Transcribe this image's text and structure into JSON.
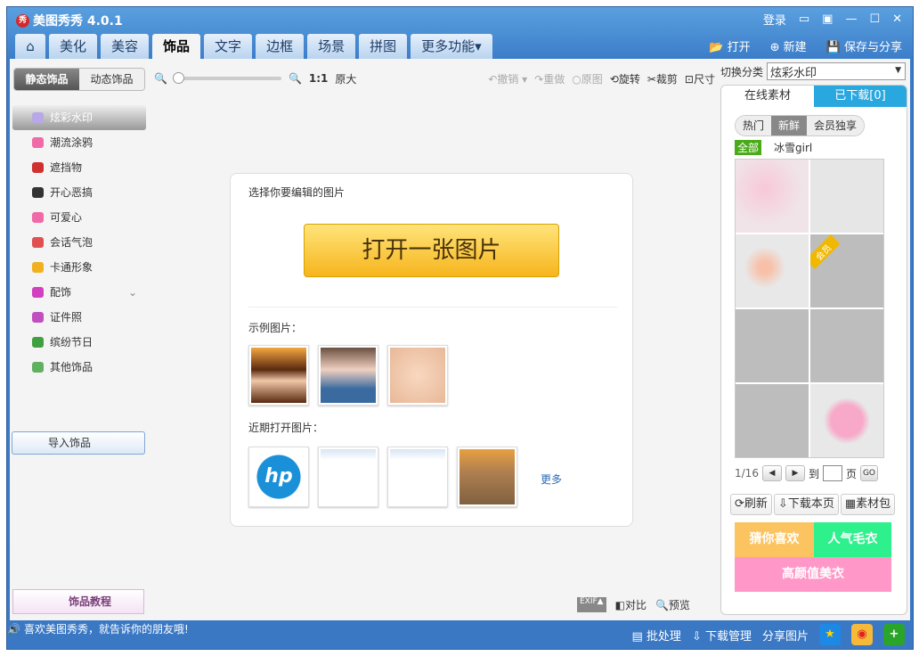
{
  "window": {
    "title": "美图秀秀 4.0.1",
    "logo": "秀",
    "login": "登录"
  },
  "tabs": [
    "美化",
    "美容",
    "饰品",
    "文字",
    "边框",
    "场景",
    "拼图",
    "更多功能▾"
  ],
  "top_actions": {
    "open": "打开",
    "new": "新建",
    "save": "保存与分享"
  },
  "left": {
    "subtabs": [
      "静态饰品",
      "动态饰品"
    ],
    "categories": [
      {
        "label": "炫彩水印",
        "color": "#b9a8e8"
      },
      {
        "label": "潮流涂鸦",
        "color": "#f06aa8"
      },
      {
        "label": "遮挡物",
        "color": "#d03030"
      },
      {
        "label": "开心恶搞",
        "color": "#333333"
      },
      {
        "label": "可爱心",
        "color": "#f06aa8"
      },
      {
        "label": "会话气泡",
        "color": "#e05050"
      },
      {
        "label": "卡通形象",
        "color": "#f0b020"
      },
      {
        "label": "配饰",
        "color": "#d040c0"
      },
      {
        "label": "证件照",
        "color": "#c050c0"
      },
      {
        "label": "缤纷节日",
        "color": "#40a040"
      },
      {
        "label": "其他饰品",
        "color": "#60b060"
      }
    ],
    "import": "导入饰品",
    "tutorial": "饰品教程"
  },
  "toolbar": {
    "zoom_label": "1:1",
    "original_size": "原大",
    "undo": "撤销",
    "redo": "重做",
    "original": "原图",
    "rotate": "旋转",
    "crop": "裁剪",
    "size": "尺寸"
  },
  "canvas": {
    "prompt": "选择你要编辑的图片",
    "open_button": "打开一张图片",
    "examples_label": "示例图片：",
    "recent_label": "近期打开图片：",
    "more": "更多"
  },
  "bottom_tools": {
    "exif": "EXIF▲",
    "compare": "对比",
    "preview": "预览"
  },
  "right": {
    "category_label": "切换分类",
    "category_value": "炫彩水印",
    "tabs": [
      "在线素材",
      "已下载[0]"
    ],
    "filters": [
      "热门",
      "新鲜",
      "会员独享"
    ],
    "tags": [
      "全部",
      "冰雪girl"
    ],
    "member_badge": "会员",
    "page": "1/16",
    "goto": "到",
    "page_unit": "页",
    "go": "GO",
    "buttons": [
      "刷新",
      "下载本页",
      "素材包"
    ],
    "promos": [
      "猜你喜欢",
      "人气毛衣",
      "高颜值美衣"
    ]
  },
  "status": {
    "message": "喜欢美图秀秀，就告诉你的朋友哦!",
    "batch": "批处理",
    "downloads": "下载管理",
    "share": "分享图片"
  }
}
